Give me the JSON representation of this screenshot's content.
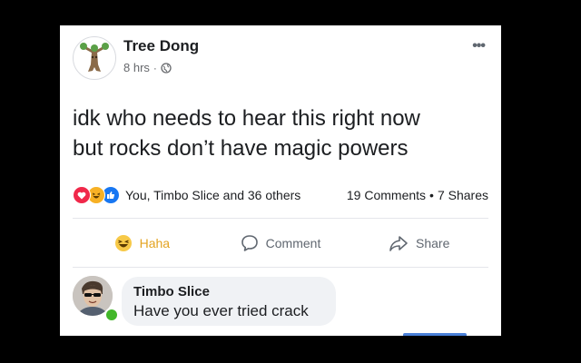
{
  "post": {
    "author": "Tree Dong",
    "time": "8 hrs",
    "separator": "·",
    "audience_icon": "globe-icon",
    "more_label": "•••",
    "text_lines": [
      "idk who needs to hear this right now",
      "but rocks don’t have magic powers"
    ],
    "reactions": {
      "icons": [
        "love-icon",
        "haha-icon",
        "like-icon"
      ],
      "label": "You, Timbo Slice and 36 others"
    },
    "comments_count": "19 Comments",
    "shares_count": "7 Shares",
    "counts_separator": "•"
  },
  "actions": [
    {
      "label": "Haha",
      "icon": "haha-icon",
      "active": true
    },
    {
      "label": "Comment",
      "icon": "comment-icon"
    },
    {
      "label": "Share",
      "icon": "share-icon"
    }
  ],
  "comment": {
    "author": "Timbo Slice",
    "text": "Have you ever tried crack",
    "online": true
  },
  "colors": {
    "background": "#000000",
    "card": "#ffffff",
    "haha_active": "#e3a321",
    "online": "#42b72a",
    "love": "#f0284a",
    "like": "#1877f2"
  }
}
